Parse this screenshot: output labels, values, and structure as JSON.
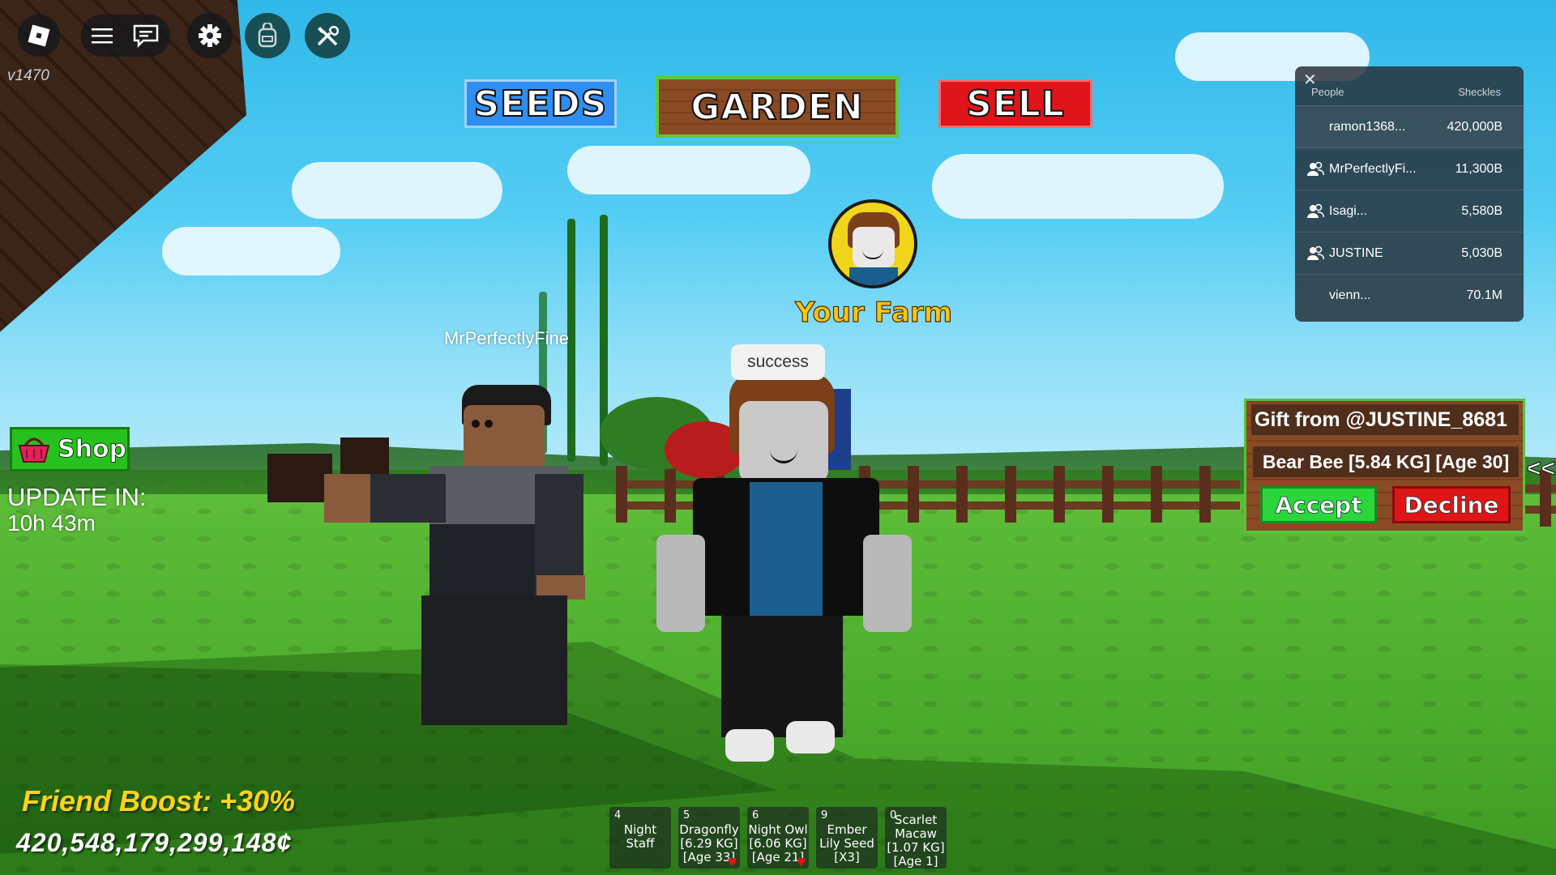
{
  "hud": {
    "version": "v1470",
    "top_icons": [
      "roblox-logo-icon",
      "menu-icon",
      "chat-icon",
      "settings-gear-icon",
      "backpack-icon",
      "build-tools-icon"
    ]
  },
  "tabs": {
    "seeds": "SEEDS",
    "garden": "GARDEN",
    "sell": "SELL"
  },
  "farm": {
    "label": "Your Farm"
  },
  "world": {
    "player_nametag": "MrPerfectlyFine",
    "chat_bubble": "success"
  },
  "shop": {
    "label": "Shop"
  },
  "update": {
    "label": "UPDATE IN:",
    "time": "10h 43m"
  },
  "stats": {
    "friend_boost": "Friend Boost: +30%",
    "money": "420,548,179,299,148¢"
  },
  "leaderboard": {
    "header_people": "People",
    "header_stat": "Sheckles",
    "rows": [
      {
        "name": "ramon1368...",
        "value": "420,000B",
        "friend": false
      },
      {
        "name": "MrPerfectlyFi...",
        "value": "11,300B",
        "friend": true
      },
      {
        "name": "Isagi...",
        "value": "5,580B",
        "friend": true
      },
      {
        "name": "JUSTINE",
        "value": "5,030B",
        "friend": true
      },
      {
        "name": "vienn...",
        "value": "70.1M",
        "friend": false
      }
    ]
  },
  "gift": {
    "title": "Gift from @JUSTINE_8681",
    "item": "Bear Bee [5.84 KG] [Age 30]",
    "accept": "Accept",
    "decline": "Decline",
    "collapse": "<<"
  },
  "hotbar": [
    {
      "key": "4",
      "label": "Night\nStaff",
      "favorite": false
    },
    {
      "key": "5",
      "label": "Dragonfly\n[6.29 KG]\n[Age 33]",
      "favorite": true
    },
    {
      "key": "6",
      "label": "Night Owl\n[6.06 KG]\n[Age 21]",
      "favorite": true
    },
    {
      "key": "9",
      "label": "Ember\nLily Seed\n[X3]",
      "favorite": false
    },
    {
      "key": "0",
      "label": "Scarlet\nMacaw\n[1.07 KG]\n[Age 1]",
      "favorite": false
    }
  ],
  "colors": {
    "seeds": "#2f8ef0",
    "sell": "#e0141b",
    "garden_border": "#5fc93d",
    "accept": "#2bd63a",
    "decline": "#e01616",
    "boost": "#ffd21c"
  }
}
